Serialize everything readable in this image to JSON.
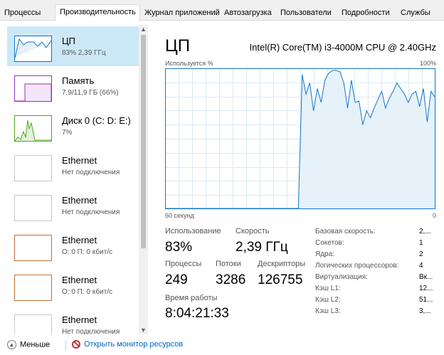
{
  "tabs": [
    {
      "label": "Процессы"
    },
    {
      "label": "Производительность",
      "active": true
    },
    {
      "label": "Журнал приложений"
    },
    {
      "label": "Автозагрузка"
    },
    {
      "label": "Пользователи"
    },
    {
      "label": "Подробности"
    },
    {
      "label": "Службы"
    }
  ],
  "sidebar": {
    "items": [
      {
        "title": "ЦП",
        "subtitle": "83% 2,39 ГГц",
        "color": "#1175c9",
        "icon": "cpu-graph",
        "selected": true
      },
      {
        "title": "Память",
        "subtitle": "7,9/11,9 ГБ (66%)",
        "color": "#9b2fc1",
        "icon": "memory-graph"
      },
      {
        "title": "Диск 0 (C: D: E:)",
        "subtitle": "7%",
        "color": "#4ca61f",
        "icon": "disk-graph"
      },
      {
        "title": "Ethernet",
        "subtitle": "Нет подключения",
        "color": "#c8c8c8",
        "icon": "ethernet-graph"
      },
      {
        "title": "Ethernet",
        "subtitle": "Нет подключения",
        "color": "#c8c8c8",
        "icon": "ethernet-graph"
      },
      {
        "title": "Ethernet",
        "subtitle": "О: 0 П: 0 кбит/с",
        "color": "#c0703a",
        "icon": "ethernet-graph"
      },
      {
        "title": "Ethernet",
        "subtitle": "О: 0 П: 0 кбит/с",
        "color": "#c0703a",
        "icon": "ethernet-graph"
      },
      {
        "title": "Ethernet",
        "subtitle": "Нет подключения",
        "color": "#c8c8c8",
        "icon": "ethernet-graph"
      }
    ]
  },
  "main": {
    "title": "ЦП",
    "cpu_model": "Intel(R) Core(TM) i3-4000M CPU @ 2.40GHz",
    "graph": {
      "y_label": "Используется %",
      "y_max_label": "100%",
      "x_left_label": "60 секунд",
      "x_right_label": "0",
      "usage_values": [
        0,
        0,
        0,
        0,
        0,
        0,
        0,
        0,
        0,
        0,
        0,
        0,
        0,
        0,
        0,
        0,
        0,
        0,
        0,
        0,
        0,
        0,
        0,
        0,
        0,
        0,
        0,
        0,
        0,
        0,
        0,
        0,
        0,
        0,
        0,
        0,
        96,
        82,
        90,
        70,
        86,
        76,
        92,
        97,
        99,
        99,
        98,
        90,
        72,
        92,
        76,
        77,
        60,
        70,
        65,
        72,
        78,
        84,
        72,
        79,
        84,
        90,
        86,
        82,
        76,
        82,
        84,
        73,
        86,
        62,
        84,
        80
      ],
      "line_color": "#1175c9",
      "fill_color": "#e6f1fa"
    },
    "stats": {
      "usage_label": "Использование",
      "usage_value": "83%",
      "speed_label": "Скорость",
      "speed_value": "2,39 ГГц",
      "processes_label": "Процессы",
      "processes_value": "249",
      "threads_label": "Потоки",
      "threads_value": "3286",
      "handles_label": "Дескрипторы",
      "handles_value": "126755",
      "uptime_label": "Время работы",
      "uptime_value": "8:04:21:33"
    },
    "specs": [
      {
        "label": "Базовая скорость:",
        "value": "2,..."
      },
      {
        "label": "Сокетов:",
        "value": "1"
      },
      {
        "label": "Ядра:",
        "value": "2"
      },
      {
        "label": "Логических процессоров:",
        "value": "4"
      },
      {
        "label": "Виртуализация:",
        "value": "Вк..."
      },
      {
        "label": "Кэш L1:",
        "value": "12..."
      },
      {
        "label": "Кэш L2:",
        "value": "51..."
      },
      {
        "label": "Кэш L3:",
        "value": "3,..."
      }
    ]
  },
  "footer": {
    "less_label": "Меньше",
    "monitor_label": "Открыть монитор ресурсов"
  }
}
